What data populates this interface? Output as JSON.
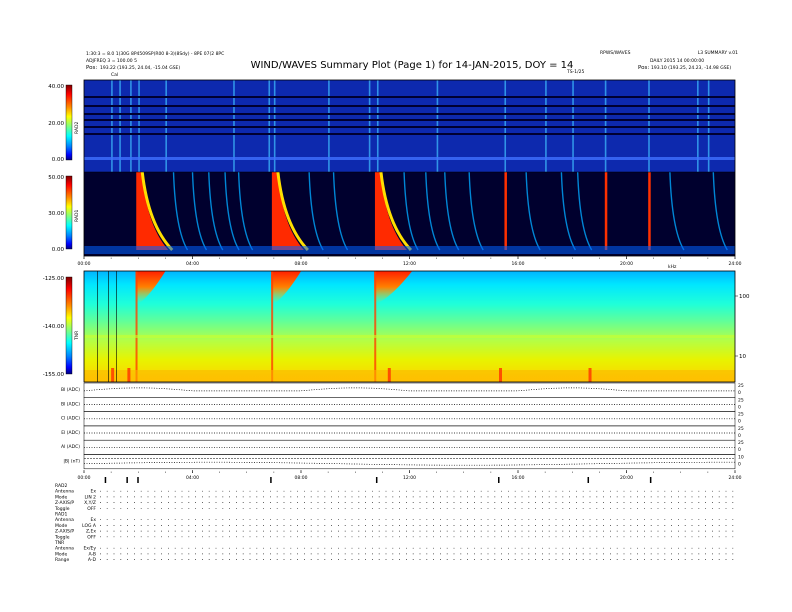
{
  "header": {
    "title": "WIND/WAVES Summary Plot (Page 1) for 14-JAN-2015, DOY = 14",
    "left_line1": "1:30:3 = 8.0 1(30G 8P4509SP(R00 8-3)(8Sdy) - 8PE 07(2 8PC",
    "left_line2": "ADJFREQ 3 = 100.00 5",
    "left_pos_label": "Pos:",
    "left_pos_value": "193.22 (193.25, 24.04, -15.04 GSE)",
    "right_top": "RPWS/WAVES",
    "right_top2": "L3 SUMMARY v.01",
    "right_line1": "DAILY 2015 14 00:00:00",
    "right_pos_label": "Pos:",
    "right_pos_value": "193.10 (193.25, 24.23, -14.98 GSE)",
    "cal_label": "Cal",
    "flag_label": "TS-1/25"
  },
  "colorbar_colors": [
    "#7f0000",
    "#ff0000",
    "#ff7f00",
    "#ffff00",
    "#7fff7f",
    "#00ffff",
    "#007fff",
    "#0000ff",
    "#00007f"
  ],
  "chart_data": [
    {
      "type": "heatmap",
      "panel": "RAD2",
      "ylabel": "RAD2",
      "yticks": [
        "40.00",
        "20.00",
        "0.00"
      ],
      "colorscale": "jet",
      "x": [
        "00:00",
        "04:00",
        "08:00",
        "12:00",
        "16:00",
        "20:00",
        "24:00"
      ]
    },
    {
      "type": "heatmap",
      "panel": "RAD1",
      "ylabel": "RAD1",
      "yticks": [
        "50.00",
        "30.00",
        "0.00"
      ],
      "colorscale": "jet",
      "x": [
        "00:00",
        "04:00",
        "08:00",
        "12:00",
        "16:00",
        "20:00",
        "24:00"
      ]
    },
    {
      "type": "heatmap",
      "panel": "TNR",
      "ylabel": "TNR",
      "yticks": [
        "-125.00",
        "-140.00",
        "-155.00"
      ],
      "right_axis_label": "kHz",
      "right_ticks": [
        "100",
        "10"
      ],
      "colorscale": "jet",
      "x": [
        "00:00",
        "04:00",
        "08:00",
        "12:00",
        "16:00",
        "20:00",
        "24:00"
      ]
    },
    {
      "type": "line",
      "panel": "line-plots",
      "series": [
        {
          "name": "Bl (ADC)",
          "right_ticks": [
            "25",
            "0"
          ]
        },
        {
          "name": "Bl (ADC)",
          "right_ticks": [
            "25",
            "0"
          ]
        },
        {
          "name": "Cl (ADC)",
          "right_ticks": [
            "25",
            "0"
          ]
        },
        {
          "name": "El (ADC)",
          "right_ticks": [
            "25",
            "0"
          ]
        },
        {
          "name": "Al (ADC)",
          "right_ticks": [
            "25",
            "0"
          ]
        },
        {
          "name": "|B| (nT)",
          "right_ticks": [
            "10",
            "0"
          ]
        }
      ],
      "x": [
        "00:00",
        "04:00",
        "08:00",
        "12:00",
        "16:00",
        "20:00",
        "24:00"
      ]
    }
  ],
  "status_table": {
    "rows": [
      {
        "label": "RAD2",
        "value": ""
      },
      {
        "label": "Antenna",
        "value": "Ex"
      },
      {
        "label": "Mode",
        "value": "LIN 2"
      },
      {
        "label": "Z-AXIS/P",
        "value": "X,Y/Z"
      },
      {
        "label": "Toggle",
        "value": "OFF"
      },
      {
        "label": "RAD1",
        "value": ""
      },
      {
        "label": "Antenna",
        "value": "Ex"
      },
      {
        "label": "Mode",
        "value": "LOG A"
      },
      {
        "label": "Z-AXIS/P",
        "value": "Z,Ex"
      },
      {
        "label": "Toggle",
        "value": "OFF"
      },
      {
        "label": "TNR",
        "value": ""
      },
      {
        "label": "Antenna",
        "value": "Ex/Ey"
      },
      {
        "label": "Mode",
        "value": "A-B"
      },
      {
        "label": "Range",
        "value": "A-D"
      }
    ]
  }
}
